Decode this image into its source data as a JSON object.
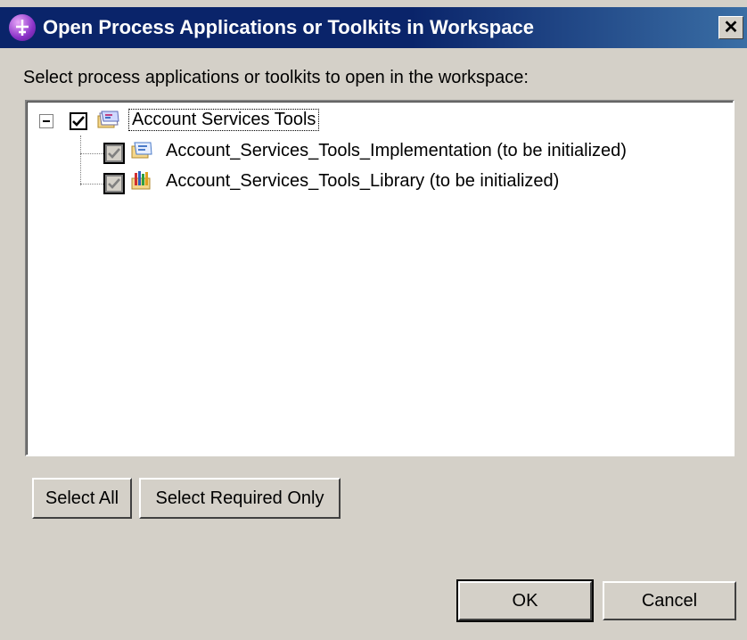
{
  "window": {
    "title": "Open Process Applications or Toolkits in Workspace",
    "close_glyph": "✕"
  },
  "instruction": "Select process applications or toolkits to open in the workspace:",
  "tree": {
    "root": {
      "label": "Account Services Tools",
      "checked": true,
      "expanded": true,
      "icon": "process-app-folder-icon"
    },
    "children": [
      {
        "label": "Account_Services_Tools_Implementation (to be initialized)",
        "checked": true,
        "disabled": true,
        "icon": "implementation-folder-icon"
      },
      {
        "label": "Account_Services_Tools_Library (to be initialized)",
        "checked": true,
        "disabled": true,
        "icon": "library-books-icon"
      }
    ]
  },
  "buttons": {
    "select_all": "Select All",
    "select_required": "Select Required Only",
    "ok": "OK",
    "cancel": "Cancel"
  }
}
